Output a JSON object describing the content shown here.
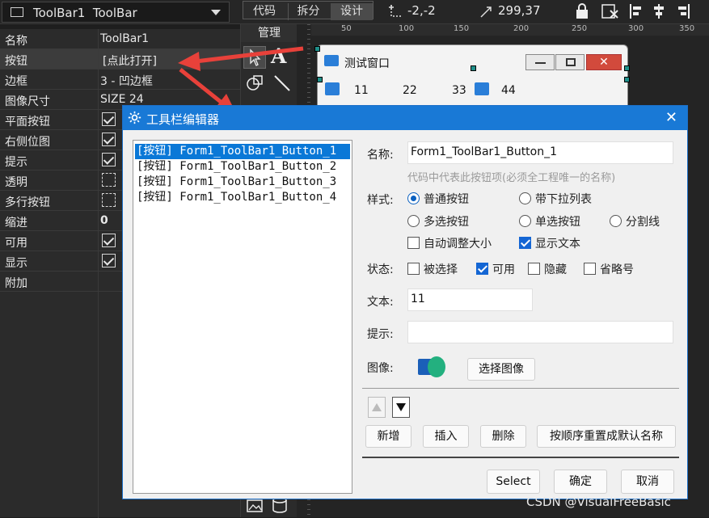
{
  "toolbar": {
    "object_name": "ToolBar1",
    "object_type": "ToolBar",
    "tabs": [
      "代码",
      "拆分",
      "设计"
    ],
    "position": "-2,-2",
    "size": "299,37"
  },
  "properties": {
    "rows": [
      {
        "key": "名称",
        "value": "ToolBar1",
        "type": "text"
      },
      {
        "key": "按钮",
        "value": "[点此打开]",
        "type": "text"
      },
      {
        "key": "边框",
        "value": "3 - 凹边框",
        "type": "text"
      },
      {
        "key": "图像尺寸",
        "value": "SIZE 24",
        "type": "text"
      },
      {
        "key": "平面按钮",
        "value": "",
        "type": "check"
      },
      {
        "key": "右侧位图",
        "value": "",
        "type": "check"
      },
      {
        "key": "提示",
        "value": "",
        "type": "check"
      },
      {
        "key": "透明",
        "value": "",
        "type": "dash"
      },
      {
        "key": "多行按钮",
        "value": "",
        "type": "dash"
      },
      {
        "key": "缩进",
        "value": "0",
        "type": "text"
      },
      {
        "key": "可用",
        "value": "",
        "type": "check"
      },
      {
        "key": "显示",
        "value": "",
        "type": "check"
      },
      {
        "key": "附加",
        "value": "",
        "type": "text"
      }
    ]
  },
  "toolbox": {
    "header": "管理"
  },
  "ruler": {
    "ticks": [
      "50",
      "100",
      "150",
      "200",
      "250",
      "300",
      "350"
    ]
  },
  "form": {
    "title": "测试窗口",
    "buttons": [
      "11",
      "22",
      "33",
      "44"
    ]
  },
  "dialog": {
    "title": "工具栏编辑器",
    "list": [
      "[按钮] Form1_ToolBar1_Button_1",
      "[按钮] Form1_ToolBar1_Button_2",
      "[按钮] Form1_ToolBar1_Button_3",
      "[按钮] Form1_ToolBar1_Button_4"
    ],
    "name_label": "名称:",
    "name_value": "Form1_ToolBar1_Button_1",
    "name_hint": "代码中代表此按钮项(必须全工程唯一的名称)",
    "style_label": "样式:",
    "styles": [
      "普通按钮",
      "带下拉列表",
      "多选按钮",
      "单选按钮",
      "分割线"
    ],
    "auto_size_label": "自动调整大小",
    "show_text_label": "显示文本",
    "state_label": "状态:",
    "states": [
      "被选择",
      "可用",
      "隐藏",
      "省略号"
    ],
    "text_label": "文本:",
    "text_value": "11",
    "tip_label": "提示:",
    "tip_value": "",
    "image_label": "图像:",
    "choose_image": "选择图像",
    "btn_new": "新增",
    "btn_insert": "插入",
    "btn_delete": "删除",
    "btn_reset": "按顺序重置成默认名称",
    "btn_select": "Select",
    "btn_ok": "确定",
    "btn_cancel": "取消"
  },
  "watermark": "CSDN @VisualFreeBasic",
  "colors": {
    "accent": "#1979d6",
    "arrow": "#e8413a"
  }
}
